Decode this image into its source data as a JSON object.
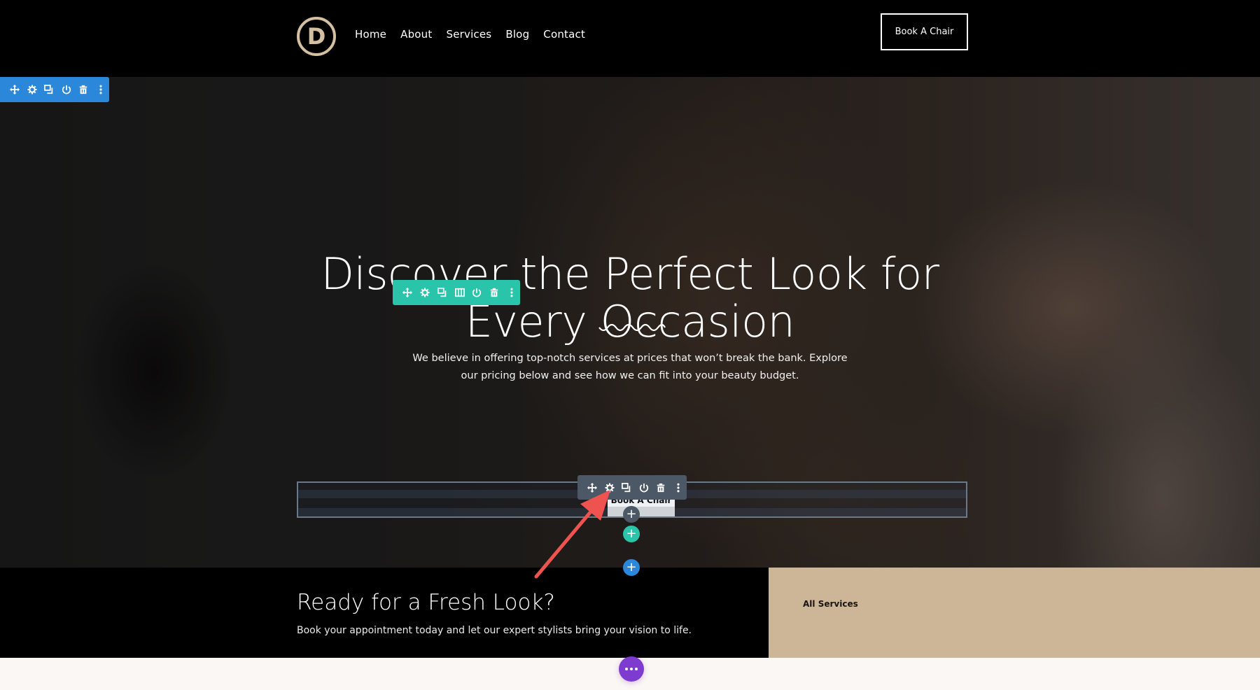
{
  "header": {
    "logo_letter": "D",
    "nav": [
      "Home",
      "About",
      "Services",
      "Blog",
      "Contact"
    ],
    "cta_label": "Book A Chair"
  },
  "hero": {
    "title": "Discover the Perfect Look for Every Occasion",
    "text": "We believe in offering top-notch services at prices that won’t break the bank. Explore our pricing below and see how we can fit into your beauty budget.",
    "module_button_label": "Book A Chair"
  },
  "builder": {
    "section_toolbar": [
      "move-icon",
      "gear-icon",
      "duplicate-icon",
      "power-icon",
      "trash-icon",
      "more-icon"
    ],
    "row_toolbar": [
      "move-icon",
      "gear-icon",
      "duplicate-icon",
      "columns-icon",
      "power-icon",
      "trash-icon",
      "more-icon"
    ],
    "module_toolbar": [
      "move-icon",
      "gear-icon",
      "duplicate-icon",
      "power-icon",
      "trash-icon",
      "more-icon"
    ],
    "add_symbol": "+",
    "colors": {
      "section": "#2b87da",
      "row": "#29c4a9",
      "module": "#4c5866",
      "page_settings": "#7e3bd0",
      "annotation_arrow": "#ef5350"
    }
  },
  "cta": {
    "title": "Ready for a Fresh Look?",
    "text": "Book your appointment today and let our expert stylists bring your vision to life.",
    "link_label": "All Services"
  },
  "colors": {
    "brand_tan": "#cdb698",
    "logo_tan": "#d4c0a1",
    "header_bg": "#000000"
  }
}
